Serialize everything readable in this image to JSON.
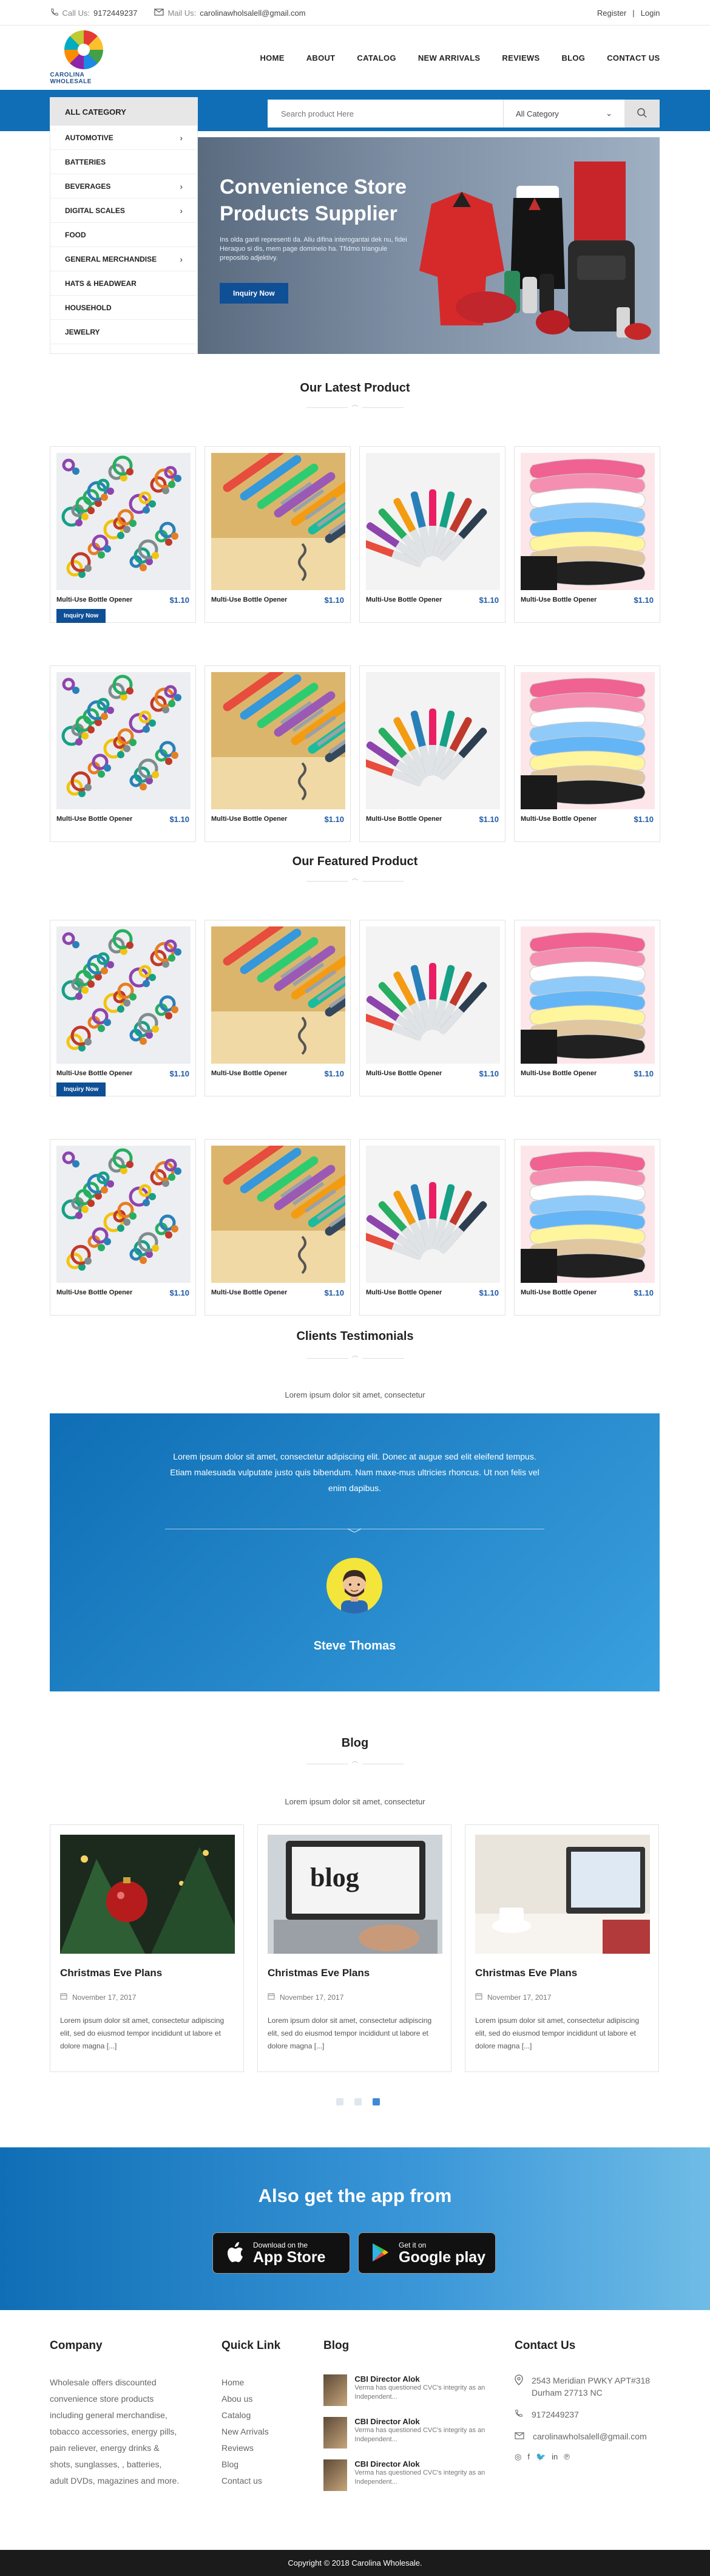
{
  "topbar": {
    "call_label": "Call Us:",
    "call_value": "9172449237",
    "mail_label": "Mail Us:",
    "mail_value": "carolinawholsalell@gmail.com",
    "register": "Register",
    "separator": "|",
    "login": "Login"
  },
  "logo": {
    "text": "CAROLINA WHOLESALE"
  },
  "nav": [
    "HOME",
    "ABOUT",
    "CATALOG",
    "NEW ARRIVALS",
    "REVIEWS",
    "BLOG",
    "CONTACT US"
  ],
  "sidebar": {
    "heading": "ALL CATEGORY",
    "items": [
      {
        "label": "AUTOMOTIVE",
        "has_sub": true
      },
      {
        "label": "BATTERIES",
        "has_sub": false
      },
      {
        "label": "BEVERAGES",
        "has_sub": true
      },
      {
        "label": "DIGITAL SCALES",
        "has_sub": true
      },
      {
        "label": "FOOD",
        "has_sub": false
      },
      {
        "label": "GENERAL MERCHANDISE",
        "has_sub": true
      },
      {
        "label": "HATS & HEADWEAR",
        "has_sub": false
      },
      {
        "label": "HOUSEHOLD",
        "has_sub": false
      },
      {
        "label": "JEWELRY",
        "has_sub": false
      }
    ]
  },
  "search": {
    "placeholder": "Search product Here",
    "category": "All Category"
  },
  "banner": {
    "title": "Convenience Store Products Supplier",
    "text": "Ins olda ganti representi da. Aliu difina interogantai dek nu, fidei Heraquo si dis, mem page dominelo ha. Tfidmo triangule prepositio adjektivy.",
    "button": "Inquiry Now"
  },
  "latest": {
    "title": "Our Latest Product",
    "products": [
      {
        "name": "Multi-Use Bottle Opener",
        "price": "$1.10",
        "image": "keys",
        "button": "Inquiry Now"
      },
      {
        "name": "Multi-Use Bottle Opener",
        "price": "$1.10",
        "image": "bottle-opener"
      },
      {
        "name": "Multi-Use Bottle Opener",
        "price": "$1.10",
        "image": "pens"
      },
      {
        "name": "Multi-Use Bottle Opener",
        "price": "$1.10",
        "image": "cables"
      },
      {
        "name": "Multi-Use Bottle Opener",
        "price": "$1.10",
        "image": "keys"
      },
      {
        "name": "Multi-Use Bottle Opener",
        "price": "$1.10",
        "image": "bottle-opener"
      },
      {
        "name": "Multi-Use Bottle Opener",
        "price": "$1.10",
        "image": "pens"
      },
      {
        "name": "Multi-Use Bottle Opener",
        "price": "$1.10",
        "image": "cables"
      }
    ]
  },
  "featured": {
    "title": "Our Featured Product",
    "products": [
      {
        "name": "Multi-Use Bottle Opener",
        "price": "$1.10",
        "image": "keys",
        "button": "Inquiry Now"
      },
      {
        "name": "Multi-Use Bottle Opener",
        "price": "$1.10",
        "image": "bottle-opener"
      },
      {
        "name": "Multi-Use Bottle Opener",
        "price": "$1.10",
        "image": "pens"
      },
      {
        "name": "Multi-Use Bottle Opener",
        "price": "$1.10",
        "image": "cables"
      },
      {
        "name": "Multi-Use Bottle Opener",
        "price": "$1.10",
        "image": "keys"
      },
      {
        "name": "Multi-Use Bottle Opener",
        "price": "$1.10",
        "image": "bottle-opener"
      },
      {
        "name": "Multi-Use Bottle Opener",
        "price": "$1.10",
        "image": "pens"
      },
      {
        "name": "Multi-Use Bottle Opener",
        "price": "$1.10",
        "image": "cables"
      }
    ]
  },
  "testimonials": {
    "title": "Clients Testimonials",
    "subtitle": "Lorem ipsum dolor sit amet, consectetur",
    "quote": "Lorem ipsum dolor sit amet, consectetur adipiscing elit. Donec at augue sed elit eleifend tempus. Etiam malesuada vulputate justo quis bibendum. Nam maxe-mus ultricies rhoncus. Ut non felis vel enim dapibus.",
    "author": "Steve Thomas"
  },
  "blog": {
    "title": "Blog",
    "subtitle": "Lorem ipsum dolor sit amet, consectetur",
    "posts": [
      {
        "title": "Christmas Eve Plans",
        "date": "November 17, 2017",
        "excerpt": "Lorem ipsum dolor sit amet, consectetur adipiscing elit, sed do eiusmod tempor incididunt ut labore et dolore magna [...]",
        "image": "christmas"
      },
      {
        "title": "Christmas Eve Plans",
        "date": "November 17, 2017",
        "excerpt": "Lorem ipsum dolor sit amet, consectetur adipiscing elit, sed do eiusmod tempor incididunt ut labore et dolore magna [...]",
        "image": "blog-laptop"
      },
      {
        "title": "Christmas Eve Plans",
        "date": "November 17, 2017",
        "excerpt": "Lorem ipsum dolor sit amet, consectetur adipiscing elit, sed do eiusmod tempor incididunt ut labore et dolore magna [...]",
        "image": "desk"
      }
    ],
    "pages": 3,
    "active_page": 3
  },
  "app": {
    "title": "Also get the app from",
    "appstore_small": "Download on the",
    "appstore_big": "App Store",
    "google_small": "Get it on",
    "google_big": "Google play"
  },
  "footer": {
    "company_title": "Company",
    "company_text": "Wholesale offers discounted convenience store products including general merchandise, tobacco accessories, energy pills, pain reliever, energy drinks & shots, sunglasses, , batteries, adult DVDs, magazines and more.",
    "quick_title": "Quick Link",
    "quick_links": [
      "Home",
      "Abou us",
      "Catalog",
      "New Arrivals",
      "Reviews",
      "Blog",
      "Contact us"
    ],
    "blog_title": "Blog",
    "blog_posts": [
      {
        "title": "CBI Director Alok",
        "text": "Verma has questioned CVC's integrity as an Independent..."
      },
      {
        "title": "CBI Director Alok",
        "text": "Verma has questioned CVC's integrity as an Independent..."
      },
      {
        "title": "CBI Director Alok",
        "text": "Verma has questioned CVC's integrity as an Independent..."
      }
    ],
    "contact_title": "Contact Us",
    "address": "2543 Meridian PWKY APT#318 Durham 27713 NC",
    "phone": "9172449237",
    "email": "carolinawholsalell@gmail.com",
    "social": [
      "instagram-icon",
      "facebook-icon",
      "twitter-icon",
      "linkedin-icon",
      "pinterest-icon"
    ]
  },
  "copyright": "Copyright © 2018 Carolina Wholesale.",
  "colors": {
    "brand_blue": "#0f6eb5",
    "button_blue": "#0f4f96",
    "price_blue": "#1f5aa6",
    "footer_dark": "#1b1b1b"
  }
}
